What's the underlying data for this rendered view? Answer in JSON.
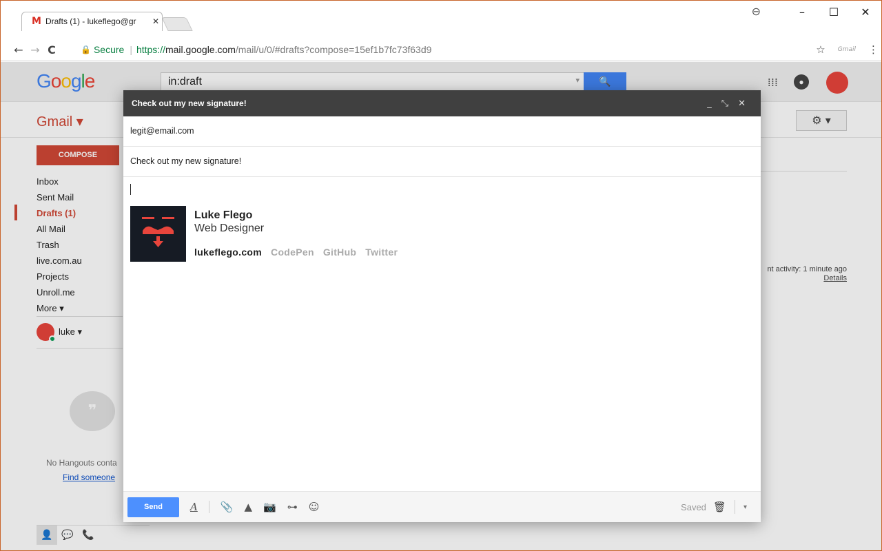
{
  "browser": {
    "tab_title": "Drafts (1) - lukeflego@gr",
    "tab_icon": "M",
    "tab_close": "✕",
    "window_controls": {
      "account": "⊖",
      "minimize": "–",
      "maximize": "☐",
      "close": "✕"
    },
    "nav": {
      "back": "←",
      "forward": "→",
      "reload": "C"
    },
    "omnibox": {
      "secure_label": "Secure",
      "url_scheme": "https://",
      "url_host": "mail.google.com",
      "url_rest": "/mail/u/0/#drafts?compose=15ef1b7fc73f63d9"
    },
    "toolbar_right": {
      "star": "☆",
      "extension": "Gmail",
      "menu": "⋮"
    }
  },
  "gmail": {
    "logo": [
      "G",
      "o",
      "o",
      "g",
      "l",
      "e"
    ],
    "search_value": "in:draft",
    "search_caret": "▾",
    "search_button": "🔍",
    "apps_icon": "⁞⁞⁞",
    "app_label": "Gmail ▾",
    "settings_label": "⚙ ▾",
    "compose_label": "COMPOSE",
    "nav_items": [
      "Inbox",
      "Sent Mail",
      "Drafts (1)",
      "All Mail",
      "Trash",
      "live.com.au",
      "Projects",
      "Unroll.me",
      "More ▾"
    ],
    "active_nav_index": 2,
    "hangouts_user": "luke ▾",
    "hangouts_bubble": "❞",
    "no_hangouts": "No Hangouts conta",
    "find_someone": "Find someone",
    "bottom_tabs": [
      "👤",
      "💬",
      "📞"
    ],
    "last_activity": "nt activity: 1 minute ago",
    "details_link": "Details"
  },
  "compose": {
    "title": "Check out my new signature!",
    "header_controls": {
      "minimize": "_",
      "popout": "⤡",
      "close": "✕"
    },
    "to": "legit@email.com",
    "subject": "Check out my new signature!",
    "signature": {
      "name": "Luke Flego",
      "role": "Web Designer",
      "links": [
        "lukeflego.com",
        "CodePen",
        "GitHub",
        "Twitter"
      ]
    },
    "send_label": "Send",
    "footer_icons": {
      "format": "A",
      "attach": "📎",
      "drive": "▲",
      "photo": "📷",
      "link": "⊶",
      "emoji": "☺"
    },
    "saved_label": "Saved",
    "trash_icon": "🗑",
    "more_options": "▾"
  },
  "colors": {
    "accent_red": "#d14836",
    "google_blue": "#4285f4",
    "compose_header": "#404040",
    "send_blue": "#4d90fe",
    "signature_bg": "#161b24",
    "signature_accent": "#e8453c"
  }
}
